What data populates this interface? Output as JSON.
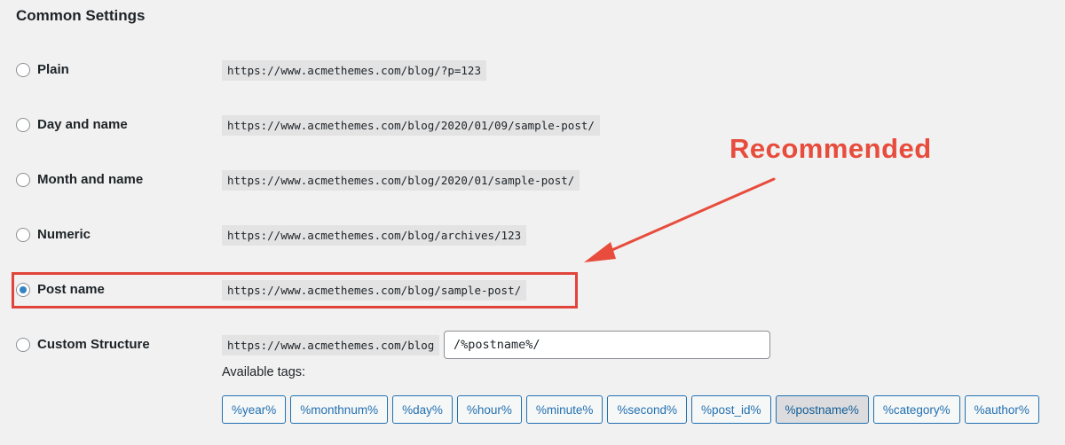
{
  "section": {
    "title": "Common Settings"
  },
  "options": [
    {
      "label": "Plain",
      "url": "https://www.acmethemes.com/blog/?p=123",
      "checked": false
    },
    {
      "label": "Day and name",
      "url": "https://www.acmethemes.com/blog/2020/01/09/sample-post/",
      "checked": false
    },
    {
      "label": "Month and name",
      "url": "https://www.acmethemes.com/blog/2020/01/sample-post/",
      "checked": false
    },
    {
      "label": "Numeric",
      "url": "https://www.acmethemes.com/blog/archives/123",
      "checked": false
    },
    {
      "label": "Post name",
      "url": "https://www.acmethemes.com/blog/sample-post/",
      "checked": true
    },
    {
      "label": "Custom Structure",
      "url": "https://www.acmethemes.com/blog",
      "checked": false
    }
  ],
  "custom": {
    "value": "/%postname%/"
  },
  "tags": {
    "label": "Available tags:",
    "items": [
      "%year%",
      "%monthnum%",
      "%day%",
      "%hour%",
      "%minute%",
      "%second%",
      "%post_id%",
      "%postname%",
      "%category%",
      "%author%"
    ],
    "active": "%postname%"
  },
  "annotation": {
    "text": "Recommended",
    "color": "#e74c3c"
  }
}
